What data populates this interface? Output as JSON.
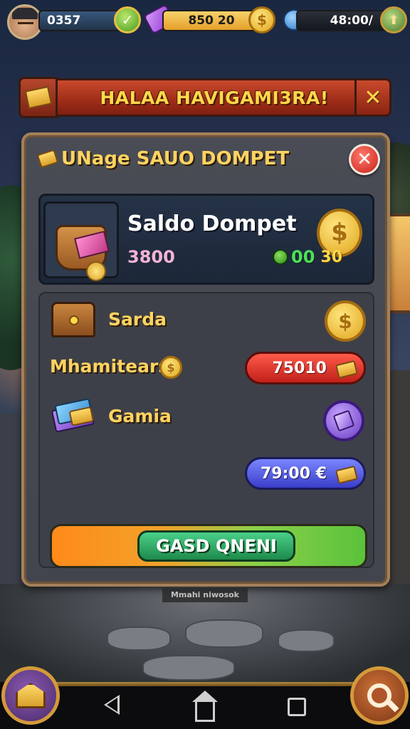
{
  "topbar": {
    "res1_value": "0357",
    "res2_value": "850 20",
    "res3_value": "48:00/",
    "coin_symbol": "$"
  },
  "banner": {
    "title": "HALAA HAVIGAMI3RA!",
    "close_symbol": "✕"
  },
  "panel": {
    "title": "UNage SAUO DOMPET",
    "close_symbol": "✕",
    "wallet": {
      "name": "Saldo Dompet",
      "amount": "3800",
      "coin_symbol": "$",
      "chips_text": "00",
      "chips_num": "30"
    },
    "rows": [
      {
        "label": "Sarda",
        "coin_symbol": "$"
      },
      {
        "label": "Mhamitears",
        "coin_symbol": "$",
        "pill_value": "75010"
      },
      {
        "label": "Gamia"
      }
    ],
    "blue_pill_value": "79:00 €",
    "cta_label": "GASD QNENI"
  },
  "watermark": "Mmahi niwosok",
  "colors": {
    "banner_text": "#ffd84a",
    "panel_title": "#ffd360",
    "pill_red": "#c0201a",
    "pill_blue": "#3a3ec8",
    "cta_green": "#1e8a4a"
  },
  "icons": [
    "avatar",
    "check-icon",
    "gem-icon",
    "coin-icon",
    "blue-orb-icon",
    "arrow-icon",
    "chest-icon",
    "close-icon",
    "wallet-bag-icon",
    "gold-coin-icon",
    "money-stack-icon",
    "gem-circle-icon",
    "home-icon",
    "search-icon"
  ]
}
